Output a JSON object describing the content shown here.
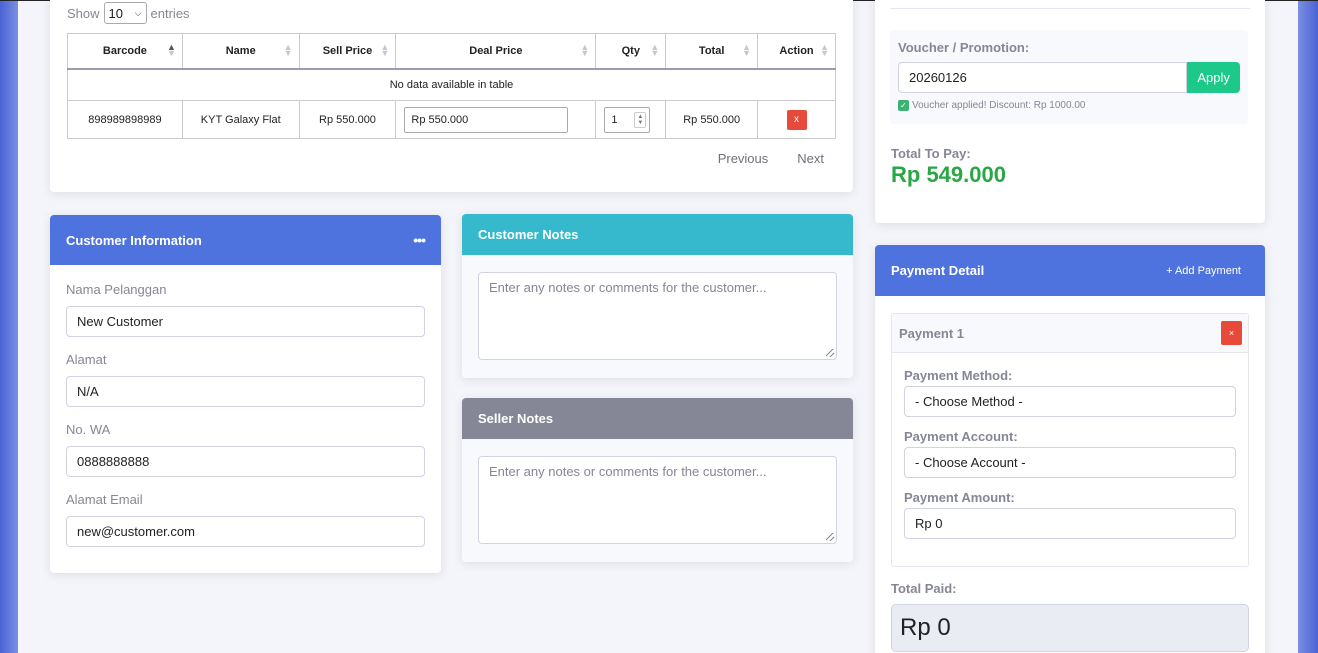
{
  "table": {
    "show_label": "Show",
    "page_size": "10",
    "entries_label": "entries",
    "columns": [
      "Barcode",
      "Name",
      "Sell Price",
      "Deal Price",
      "Qty",
      "Total",
      "Action"
    ],
    "empty_message": "No data available in table",
    "rows": [
      {
        "barcode": "898989898989",
        "name": "KYT Galaxy Flat",
        "sell_price": "Rp 550.000",
        "deal_price": "Rp 550.000",
        "qty": "1",
        "total": "Rp 550.000",
        "action": "x"
      }
    ],
    "previous_label": "Previous",
    "next_label": "Next"
  },
  "customer_info": {
    "title": "Customer Information",
    "menu_icon": "ellipsis-icon",
    "fields": [
      {
        "label": "Nama Pelanggan",
        "value": "New Customer"
      },
      {
        "label": "Alamat",
        "value": "N/A"
      },
      {
        "label": "No. WA",
        "value": "0888888888"
      },
      {
        "label": "Alamat Email",
        "value": "new@customer.com"
      }
    ]
  },
  "customer_notes": {
    "title": "Customer Notes",
    "placeholder": "Enter any notes or comments for the customer..."
  },
  "seller_notes": {
    "title": "Seller Notes",
    "placeholder": "Enter any notes or comments for the customer..."
  },
  "summary": {
    "voucher_label": "Voucher / Promotion:",
    "voucher_code": "20260126",
    "apply_label": "Apply",
    "voucher_message": "Voucher applied! Discount: Rp 1000.00",
    "total_to_pay_label": "Total To Pay:",
    "total_to_pay_value": "Rp 549.000"
  },
  "payment": {
    "title": "Payment Detail",
    "add_label": "+ Add Payment",
    "item_title": "Payment 1",
    "remove_label": "×",
    "method_label": "Payment Method:",
    "method_value": "- Choose Method -",
    "account_label": "Payment Account:",
    "account_value": "- Choose Account -",
    "amount_label": "Payment Amount:",
    "amount_value": "Rp 0",
    "total_paid_label": "Total Paid:",
    "total_paid_value": "Rp 0"
  },
  "colors": {
    "primary": "#4e73df",
    "info": "#36b9cc",
    "secondary": "#858796",
    "success": "#1cc88a",
    "danger": "#e74a3b",
    "total_green": "#28a745"
  }
}
